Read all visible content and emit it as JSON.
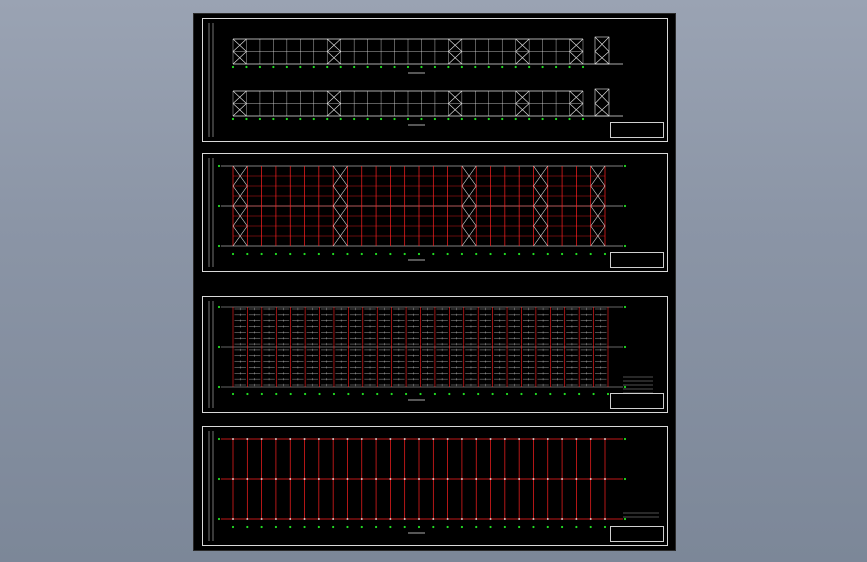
{
  "viewer": {
    "background_top": "#9aa3b3",
    "background_bottom": "#7c8798"
  },
  "sheet": {
    "background": "#000000",
    "panels": [
      {
        "id": "elevations",
        "style": "white-frame-elevation",
        "bays": 26,
        "braced_bays": [
          1,
          8,
          17,
          22,
          26
        ],
        "title_block_text": ""
      },
      {
        "id": "roof-bracing-plan",
        "style": "red-purlin-plan",
        "bays": 26,
        "braced_bays": [
          1,
          8,
          17,
          22,
          26
        ],
        "title_block_text": ""
      },
      {
        "id": "purlin-layout-plan",
        "style": "dense-grid-plan",
        "bays": 26,
        "braced_bays": [],
        "title_block_text": ""
      },
      {
        "id": "column-layout-plan",
        "style": "red-grid-plan",
        "bays": 26,
        "braced_bays": [],
        "title_block_text": ""
      }
    ]
  },
  "colors": {
    "frame_line": "#e6e6e6",
    "member_red": "#ff2020",
    "grid_marker": "#22dd22",
    "axis_line": "#ffffff"
  }
}
